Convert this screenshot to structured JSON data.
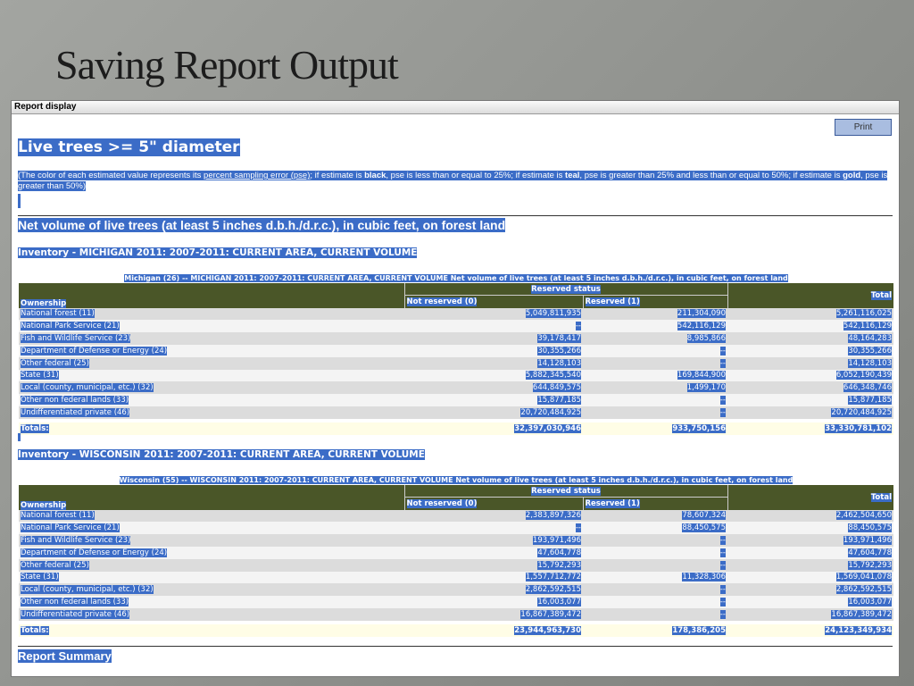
{
  "slide": {
    "title": "Saving Report Output"
  },
  "window": {
    "title": "Report display",
    "print_label": "Print"
  },
  "report": {
    "heading": "Live trees >= 5\" diameter",
    "note": {
      "p1": "(The color of each estimated value represents its ",
      "link": "percent sampling error (pse)",
      "p2": "; if estimate is ",
      "black": "black",
      "p3": ", pse is less than or equal to 25%; if estimate is ",
      "teal": "teal",
      "p4": ", pse is greater than 25% and less than or equal to 50%; if estimate is ",
      "gold": "gold",
      "p5": ", pse is greater than 50%)"
    },
    "subheading": "Net volume of live trees (at least 5 inches d.b.h./d.r.c.), in cubic feet, on forest land",
    "summary": "Report Summary"
  },
  "tables": [
    {
      "inventory": "Inventory - MICHIGAN 2011: 2007-2011: CURRENT AREA, CURRENT VOLUME",
      "caption": "Michigan (26) -- MICHIGAN 2011: 2007-2011: CURRENT AREA, CURRENT VOLUME Net volume of live trees (at least 5 inches d.b.h./d.r.c.), in cubic feet, on forest land",
      "group": "Reserved status",
      "headers": [
        "Ownership",
        "Not reserved (0)",
        "Reserved (1)",
        "Total"
      ],
      "rows": [
        [
          "National forest (11)",
          "5,049,811,935",
          "211,304,090",
          "5,261,116,025"
        ],
        [
          "National Park Service (21)",
          "--",
          "542,116,129",
          "542,116,129"
        ],
        [
          "Fish and Wildlife Service (23)",
          "39,178,417",
          "8,985,866",
          "48,164,283"
        ],
        [
          "Department of Defense or Energy (24)",
          "30,355,266",
          "--",
          "30,355,266"
        ],
        [
          "Other federal (25)",
          "14,128,103",
          "--",
          "14,128,103"
        ],
        [
          "State (31)",
          "5,882,345,540",
          "169,844,900",
          "6,052,190,439"
        ],
        [
          "Local (county, municipal, etc.) (32)",
          "644,849,575",
          "1,499,170",
          "646,348,746"
        ],
        [
          "Other non federal lands (33)",
          "15,877,185",
          "--",
          "15,877,185"
        ],
        [
          "Undifferentiated private (46)",
          "20,720,484,925",
          "--",
          "20,720,484,925"
        ]
      ],
      "totals": [
        "Totals:",
        "32,397,030,946",
        "933,750,156",
        "33,330,781,102"
      ]
    },
    {
      "inventory": "Inventory - WISCONSIN 2011: 2007-2011: CURRENT AREA, CURRENT VOLUME",
      "caption": "Wisconsin (55) -- WISCONSIN 2011: 2007-2011: CURRENT AREA, CURRENT VOLUME Net volume of live trees (at least 5 inches d.b.h./d.r.c.), in cubic feet, on forest land",
      "group": "Reserved status",
      "headers": [
        "Ownership",
        "Not reserved (0)",
        "Reserved (1)",
        "Total"
      ],
      "rows": [
        [
          "National forest (11)",
          "2,383,897,326",
          "78,607,324",
          "2,462,504,650"
        ],
        [
          "National Park Service (21)",
          "--",
          "88,450,575",
          "88,450,575"
        ],
        [
          "Fish and Wildlife Service (23)",
          "193,971,496",
          "--",
          "193,971,496"
        ],
        [
          "Department of Defense or Energy (24)",
          "47,604,778",
          "--",
          "47,604,778"
        ],
        [
          "Other federal (25)",
          "15,792,293",
          "--",
          "15,792,293"
        ],
        [
          "State (31)",
          "1,557,712,772",
          "11,328,306",
          "1,569,041,078"
        ],
        [
          "Local (county, municipal, etc.) (32)",
          "2,862,592,515",
          "--",
          "2,862,592,515"
        ],
        [
          "Other non federal lands (33)",
          "16,003,077",
          "--",
          "16,003,077"
        ],
        [
          "Undifferentiated private (46)",
          "16,867,389,472",
          "--",
          "16,867,389,472"
        ]
      ],
      "totals": [
        "Totals:",
        "23,944,963,730",
        "178,386,205",
        "24,123,349,934"
      ]
    }
  ]
}
